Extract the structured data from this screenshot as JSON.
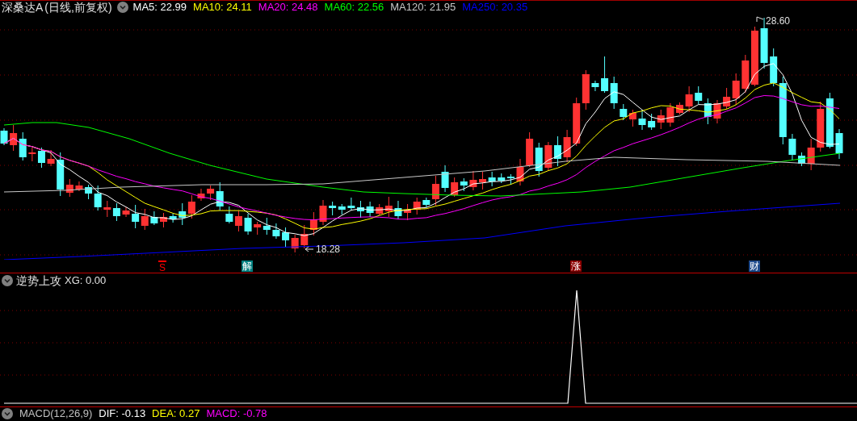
{
  "header": {
    "title": "深桑达A",
    "subtitle": "(日线,前复权)",
    "ma": [
      {
        "label": "MA5: 22.99",
        "color": "#ffffff"
      },
      {
        "label": "MA10: 24.11",
        "color": "#ffff00"
      },
      {
        "label": "MA20: 24.48",
        "color": "#ff00ff"
      },
      {
        "label": "MA60: 22.56",
        "color": "#00ff00"
      },
      {
        "label": "MA120: 21.95",
        "color": "#c8c8c8"
      },
      {
        "label": "MA250: 20.35",
        "color": "#0000ff"
      }
    ]
  },
  "price_chart": {
    "high_label": "28.60",
    "low_label": "18.28"
  },
  "markers": [
    {
      "kind": "arrow",
      "text": "S",
      "color": "#ff0000"
    },
    {
      "kind": "tag",
      "text": "解",
      "color": "#008080"
    },
    {
      "kind": "tag",
      "text": "涨",
      "color": "#8b0000"
    },
    {
      "kind": "tag",
      "text": "财",
      "color": "#1e4a8c"
    }
  ],
  "indicator": {
    "name": "逆势上攻",
    "value": "XG: 0.00"
  },
  "macd": {
    "name": "MACD(12,26,9)",
    "values": [
      {
        "label": "DIF: -0.13",
        "color": "#ffffff"
      },
      {
        "label": "DEA: 0.27",
        "color": "#ffff00"
      },
      {
        "label": "MACD: -0.78",
        "color": "#ff00ff"
      }
    ]
  }
}
